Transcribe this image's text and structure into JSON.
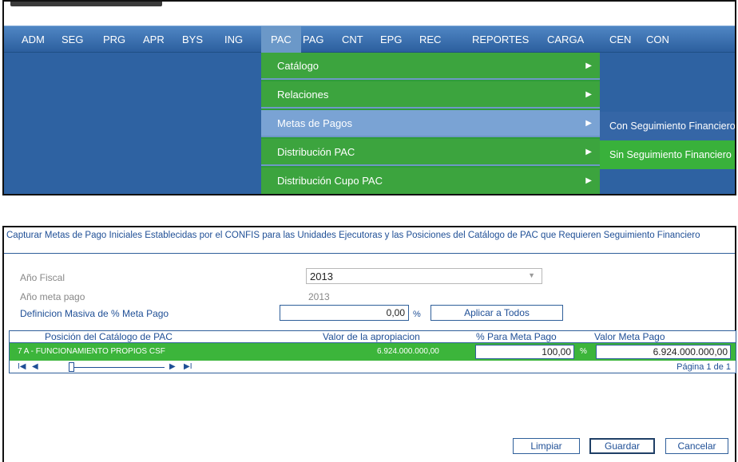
{
  "menubar": {
    "items": [
      "ADM",
      "SEG",
      "PRG",
      "APR",
      "BYS",
      "ING",
      "PAC",
      "PAG",
      "CNT",
      "EPG",
      "REC",
      "REPORTES",
      "CARGA",
      "CEN",
      "CON"
    ],
    "active": "PAC"
  },
  "dropdown": {
    "items": [
      "Catálogo",
      "Relaciones",
      "Metas de Pagos",
      "Distribución PAC",
      "Distribución Cupo PAC"
    ],
    "highlighted": "Metas de Pagos"
  },
  "submenu": {
    "items": [
      "Con Seguimiento Financiero",
      "Sin Seguimiento Financiero"
    ]
  },
  "form": {
    "title": "Capturar Metas de Pago Iniciales Establecidas por el CONFIS para las Unidades Ejecutoras y las Posiciones del Catálogo de PAC que Requieren Seguimiento Financiero",
    "fiscal_year_label": "Año Fiscal",
    "fiscal_year_value": "2013",
    "meta_year_label": "Año meta pago",
    "meta_year_value": "2013",
    "bulk_label": "Definicion Masiva de % Meta Pago",
    "bulk_value": "0,00",
    "percent_symbol": "%",
    "apply_all_button": "Aplicar a Todos"
  },
  "grid": {
    "headers": [
      "Posición del Catálogo de PAC",
      "Valor de la apropiacion",
      "% Para Meta Pago",
      "Valor Meta Pago"
    ],
    "rows": [
      {
        "position": "7 A - FUNCIONAMIENTO PROPIOS CSF",
        "appropriation": "6.924.000.000,00",
        "percent": "100,00",
        "percent_symbol": "%",
        "goal_value": "6.924.000.000,00"
      }
    ],
    "pager": {
      "first": "I◀",
      "prev": "◀",
      "next": "▶",
      "last": "▶I",
      "page_label": "Página 1 de 1"
    }
  },
  "actions": {
    "clear": "Limpiar",
    "save": "Guardar",
    "cancel": "Cancelar"
  },
  "colors": {
    "menu_blue": "#2f5f9a",
    "menu_green": "#3ca43e",
    "highlight_blue": "#7aa3d4",
    "text_blue": "#1f4f96"
  }
}
